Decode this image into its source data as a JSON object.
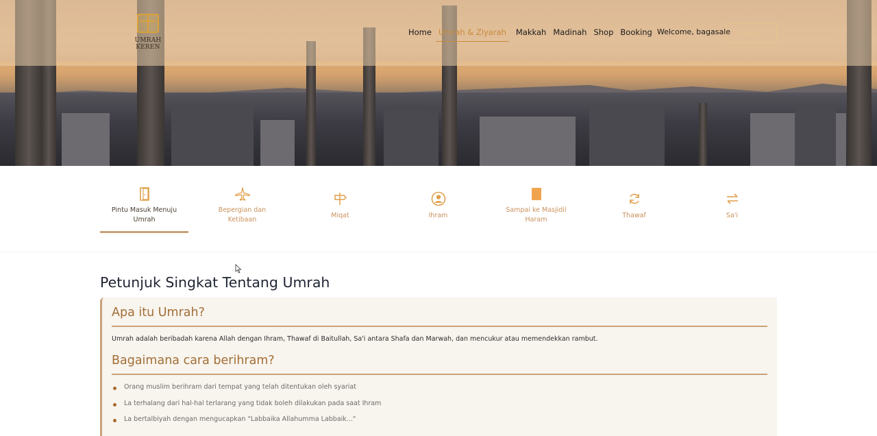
{
  "brand": {
    "logo_text": "UMRAH KEREN"
  },
  "nav": {
    "items": [
      {
        "label": "Home",
        "active": false
      },
      {
        "label": "Umrah & Ziyarah",
        "active": true
      },
      {
        "label": "Makkah",
        "active": false
      },
      {
        "label": "Madinah",
        "active": false
      },
      {
        "label": "Shop",
        "active": false
      },
      {
        "label": "Booking",
        "active": false
      }
    ],
    "welcome": "Welcome, bagasale",
    "logout_label": "Logout"
  },
  "steps": [
    {
      "label": "Pintu Masuk Menuju Umrah",
      "icon": "door-icon",
      "active": true
    },
    {
      "label": "Bepergian dan Ketibaan",
      "icon": "airplane-icon",
      "active": false
    },
    {
      "label": "Miqat",
      "icon": "signpost-icon",
      "active": false
    },
    {
      "label": "Ihram",
      "icon": "person-circle-icon",
      "active": false
    },
    {
      "label": "Sampai ke Masjidil Haram",
      "icon": "book-icon",
      "active": false
    },
    {
      "label": "Thawaf",
      "icon": "refresh-icon",
      "active": false
    },
    {
      "label": "Sa'i",
      "icon": "arrows-swap-icon",
      "active": false
    }
  ],
  "content": {
    "page_title": "Petunjuk Singkat Tentang Umrah",
    "sections": [
      {
        "heading": "Apa itu Umrah?",
        "text": "Umrah adalah beribadah karena Allah dengan Ihram, Thawaf di Baitullah, Sa'i antara Shafa dan Marwah, dan mencukur atau memendekkan rambut."
      },
      {
        "heading": "Bagaimana cara berihram?",
        "items": [
          "Orang muslim berihram dari tempat yang telah ditentukan oleh syariat",
          "La terhalang dari hal-hal terlarang yang tidak boleh dilakukan pada saat Ihram",
          "La bertalbiyah dengan mengucapkan \"Labbaika Allahumma Labbaik...\""
        ]
      }
    ]
  },
  "colors": {
    "accent": "#c8a27a",
    "heading": "#a26e35",
    "tab_label": "#c9915a",
    "card_bg": "#f8f4ee"
  }
}
